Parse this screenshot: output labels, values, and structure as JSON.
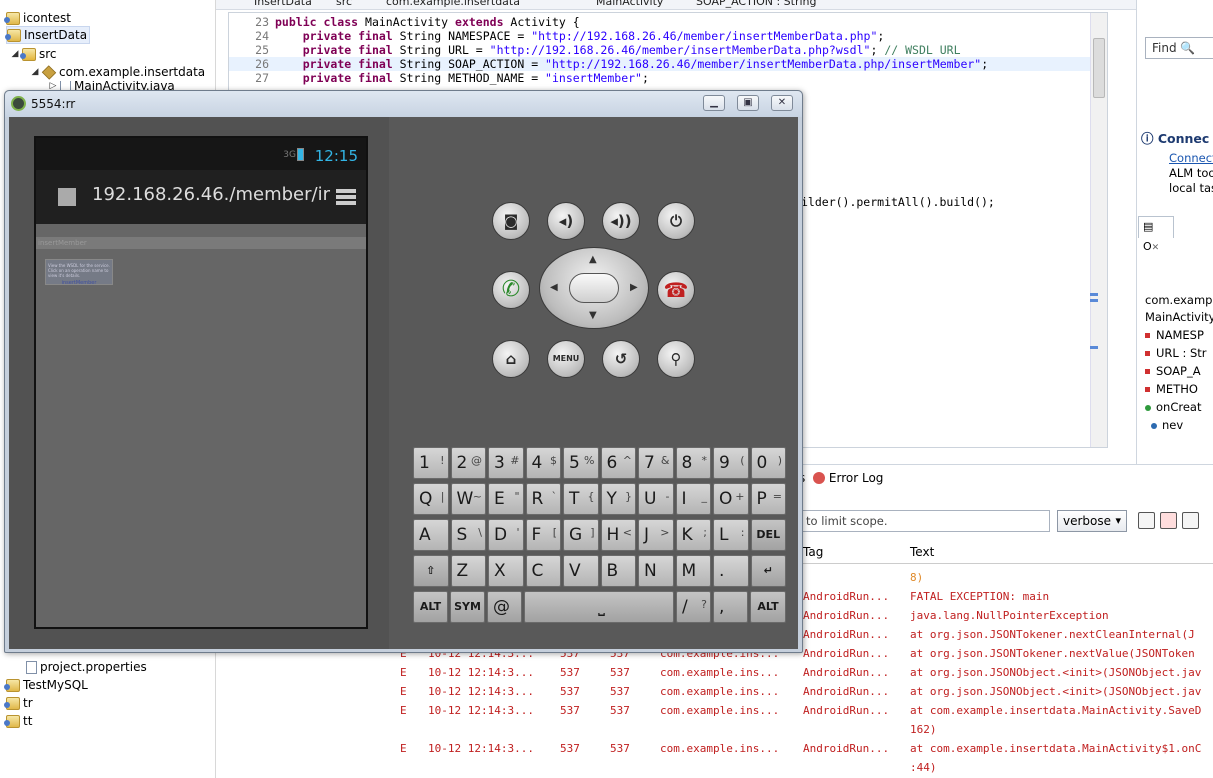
{
  "explorer": {
    "items": [
      {
        "label": "icontest",
        "type": "project"
      },
      {
        "label": "InsertData",
        "type": "project",
        "selected": true
      },
      {
        "label": "src",
        "type": "folder"
      },
      {
        "label": "com.example.insertdata",
        "type": "package"
      },
      {
        "label": "MainActivity.java",
        "type": "file"
      },
      {
        "label": "project.properties",
        "type": "file"
      },
      {
        "label": "TestMySQL",
        "type": "project"
      },
      {
        "label": "tr",
        "type": "project"
      },
      {
        "label": "tt",
        "type": "project"
      }
    ]
  },
  "breadcrumb": [
    "InsertData",
    "src",
    "com.example.insertdata",
    "MainActivity",
    "SOAP_ACTION : String"
  ],
  "editor": {
    "lines": [
      {
        "num": "23",
        "kw": "public class",
        "rest": " MainActivity ",
        "kw2": "extends",
        "rest2": " Activity {"
      },
      {
        "num": "24",
        "prefix": "    ",
        "kw": "private final",
        "rest": " String NAMESPACE = ",
        "str": "\"http://192.168.26.46/member/insertMemberData.php\"",
        "tail": ";"
      },
      {
        "num": "25",
        "prefix": "    ",
        "kw": "private final",
        "rest": " String URL = ",
        "str": "\"http://192.168.26.46/member/insertMemberData.php?wsdl\"",
        "tail": "; ",
        "cmt": "// WSDL URL"
      },
      {
        "num": "26",
        "prefix": "    ",
        "kw": "private final",
        "rest": " String SOAP_ACTION = ",
        "str": "\"http://192.168.26.46/member/insertMemberData.php/insertMember\"",
        "tail": ";",
        "highlight": true
      },
      {
        "num": "27",
        "prefix": "    ",
        "kw": "private final",
        "rest": " String METHOD_NAME = ",
        "str": "\"insertMember\"",
        "tail": ";"
      }
    ],
    "partial_line": "ilder().permitAll().build();"
  },
  "right_panel": {
    "find_label": "Find",
    "connect_title": "Connec",
    "connect_link": "Connect",
    "connect_desc1": "ALM too",
    "connect_desc2": "local task",
    "outline_tab": "O",
    "outline": {
      "package": "com.example",
      "class": "MainActivity",
      "members": [
        {
          "name": "NAMESP",
          "kind": "field"
        },
        {
          "name": "URL : Str",
          "kind": "field"
        },
        {
          "name": "SOAP_A",
          "kind": "field"
        },
        {
          "name": "METHO",
          "kind": "field"
        },
        {
          "name": "onCreat",
          "kind": "method"
        },
        {
          "name": "nev",
          "kind": "anon"
        }
      ]
    }
  },
  "logcat": {
    "tab_prefix": "s",
    "tab_label": "Error Log",
    "filter_placeholder": "to limit scope.",
    "level": "verbose",
    "headers": {
      "tag": "Tag",
      "text": "Text"
    },
    "rows": [
      {
        "level": "",
        "time": "",
        "pid": "",
        "tid": "",
        "app": "",
        "tag": "",
        "text": "8)"
      },
      {
        "level": "",
        "time": "",
        "pid": "",
        "tid": "",
        "app": "",
        "tag": "AndroidRun...",
        "text": "FATAL EXCEPTION: main"
      },
      {
        "level": "",
        "time": "",
        "pid": "",
        "tid": "",
        "app": "",
        "tag": "AndroidRun...",
        "text": "java.lang.NullPointerException"
      },
      {
        "level": "",
        "time": "",
        "pid": "",
        "tid": "",
        "app": "",
        "tag": "AndroidRun...",
        "text": "at org.json.JSONTokener.nextCleanInternal(J"
      },
      {
        "level": "E",
        "time": "10-12 12:14:3...",
        "pid": "537",
        "tid": "537",
        "app": "com.example.ins...",
        "tag": "AndroidRun...",
        "text": "at org.json.JSONTokener.nextValue(JSONToken"
      },
      {
        "level": "E",
        "time": "10-12 12:14:3...",
        "pid": "537",
        "tid": "537",
        "app": "com.example.ins...",
        "tag": "AndroidRun...",
        "text": "at org.json.JSONObject.<init>(JSONObject.jav"
      },
      {
        "level": "E",
        "time": "10-12 12:14:3...",
        "pid": "537",
        "tid": "537",
        "app": "com.example.ins...",
        "tag": "AndroidRun...",
        "text": "at org.json.JSONObject.<init>(JSONObject.jav"
      },
      {
        "level": "E",
        "time": "10-12 12:14:3...",
        "pid": "537",
        "tid": "537",
        "app": "com.example.ins...",
        "tag": "AndroidRun...",
        "text": "at com.example.insertdata.MainActivity.SaveD"
      },
      {
        "level": "",
        "time": "",
        "pid": "",
        "tid": "",
        "app": "",
        "tag": "",
        "text": "162)"
      },
      {
        "level": "E",
        "time": "10-12 12:14:3...",
        "pid": "537",
        "tid": "537",
        "app": "com.example.ins...",
        "tag": "AndroidRun...",
        "text": "at com.example.insertdata.MainActivity$1.onC"
      },
      {
        "level": "",
        "time": "",
        "pid": "",
        "tid": "",
        "app": "",
        "tag": "",
        "text": ":44)"
      }
    ]
  },
  "emulator": {
    "title": "5554:rr",
    "status": {
      "signal": "3G",
      "clock": "12:15"
    },
    "action_bar_title": "192.168.26.46./member/ir",
    "web_header": "insertMember",
    "web_text": "View the WSDL for the service. Click on an operation name to view it's details.",
    "web_link": "insertMember",
    "hw_buttons": [
      "camera",
      "volume-down",
      "volume-up",
      "power",
      "call",
      "end-call",
      "home",
      "MENU",
      "back",
      "search"
    ],
    "keyboard": {
      "row1": [
        [
          "1",
          "!"
        ],
        [
          "2",
          "@"
        ],
        [
          "3",
          "#"
        ],
        [
          "4",
          "$"
        ],
        [
          "5",
          "%"
        ],
        [
          "6",
          "^"
        ],
        [
          "7",
          "&"
        ],
        [
          "8",
          "*"
        ],
        [
          "9",
          "("
        ],
        [
          "0",
          ")"
        ]
      ],
      "row2": [
        [
          "Q",
          "|"
        ],
        [
          "W",
          "~"
        ],
        [
          "E",
          "\""
        ],
        [
          "R",
          "`"
        ],
        [
          "T",
          "{"
        ],
        [
          "Y",
          "}"
        ],
        [
          "U",
          "-"
        ],
        [
          "I",
          "_"
        ],
        [
          "O",
          "+"
        ],
        [
          "P",
          "="
        ]
      ],
      "row3": [
        [
          "A",
          ""
        ],
        [
          "S",
          "\\"
        ],
        [
          "D",
          "'"
        ],
        [
          "F",
          "["
        ],
        [
          "G",
          "]"
        ],
        [
          "H",
          "<"
        ],
        [
          "J",
          ">"
        ],
        [
          "K",
          ";"
        ],
        [
          "L",
          ":"
        ],
        [
          "DEL",
          ""
        ]
      ],
      "row4": [
        [
          "⇧",
          ""
        ],
        [
          "Z",
          ""
        ],
        [
          "X",
          ""
        ],
        [
          "C",
          ""
        ],
        [
          "V",
          ""
        ],
        [
          "B",
          ""
        ],
        [
          "N",
          ""
        ],
        [
          "M",
          ""
        ],
        [
          ".",
          ""
        ],
        [
          "↵",
          ""
        ]
      ],
      "row5": {
        "alt": "ALT",
        "sym": "SYM",
        "at": "@",
        "slash": "/",
        "question": "?",
        "comma": ",",
        "alt2": "ALT"
      }
    }
  }
}
